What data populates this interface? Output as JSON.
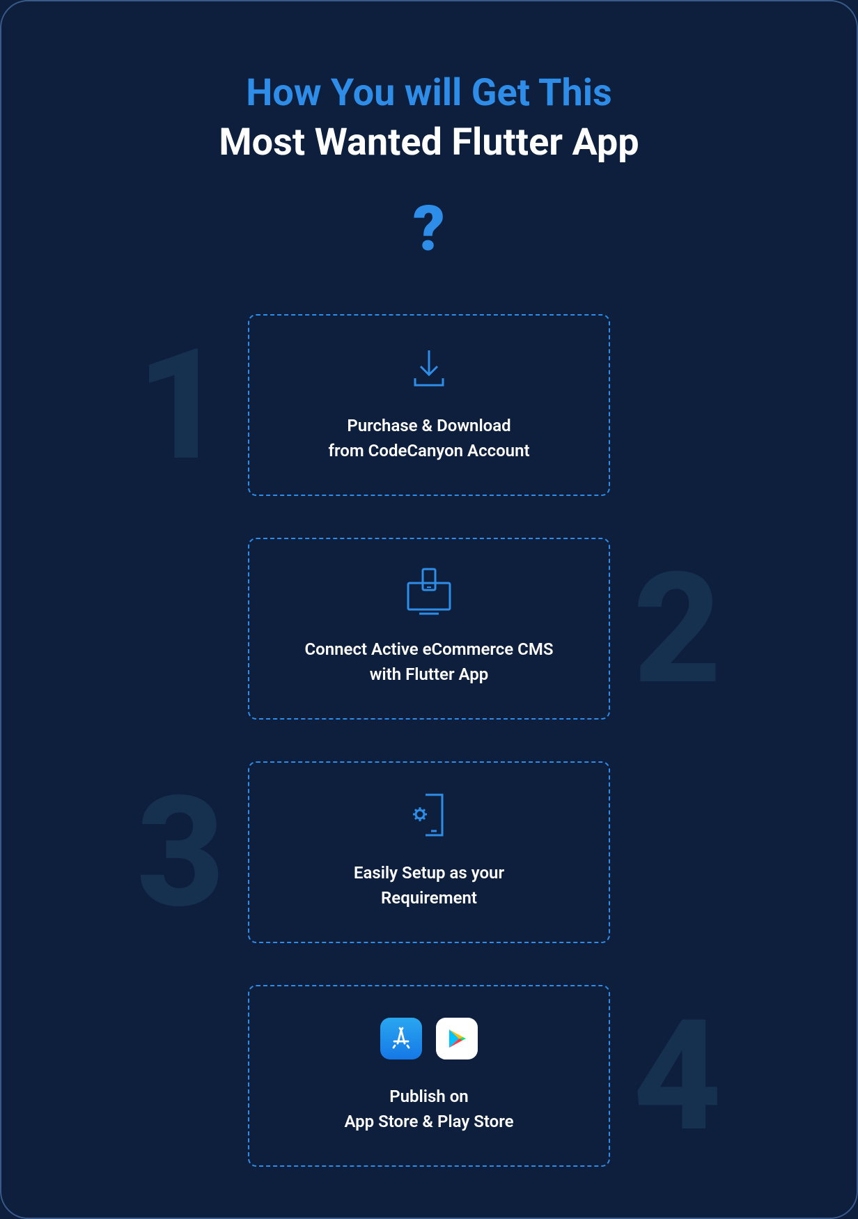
{
  "header": {
    "title_line1": "How You will Get This",
    "title_line2": "Most Wanted Flutter App",
    "question_mark": "?"
  },
  "steps": [
    {
      "number": "1",
      "number_position": "left",
      "icon": "download-icon",
      "text_line1": "Purchase & Download",
      "text_line2": "from CodeCanyon Account"
    },
    {
      "number": "2",
      "number_position": "right",
      "icon": "connect-device-icon",
      "text_line1": "Connect Active eCommerce CMS",
      "text_line2": "with Flutter App"
    },
    {
      "number": "3",
      "number_position": "left",
      "icon": "configure-device-icon",
      "text_line1": "Easily Setup as your",
      "text_line2": "Requirement"
    },
    {
      "number": "4",
      "number_position": "right",
      "icon": "publish-stores-icon",
      "text_line1": "Publish on",
      "text_line2": "App Store & Play Store"
    }
  ],
  "colors": {
    "background": "#0d1f3c",
    "accent": "#2e8de8",
    "bg_number": "#16314f",
    "text_white": "#ffffff"
  }
}
